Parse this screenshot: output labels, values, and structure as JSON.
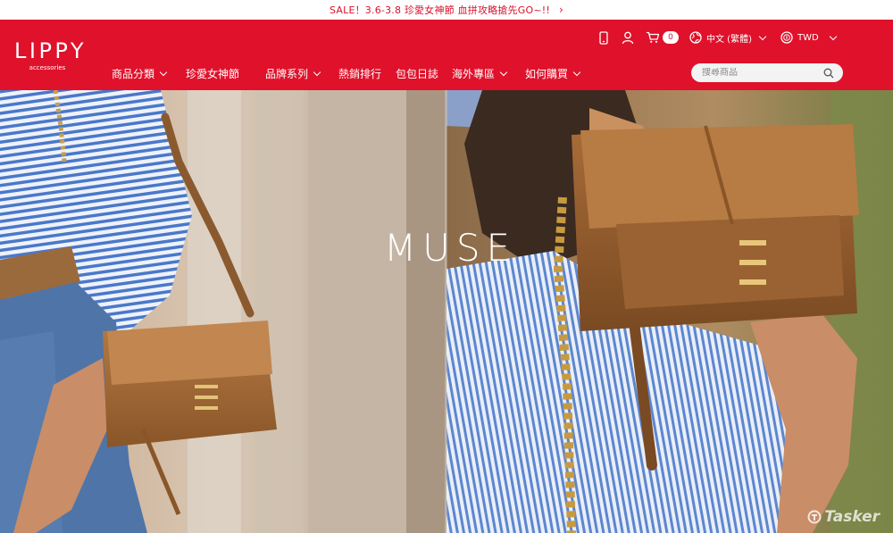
{
  "announcement": {
    "text": "SALE！3.6-3.8 珍愛女神節 血拼攻略搶先GO~!!"
  },
  "brand": {
    "name": "LIPPY",
    "tagline": "accessories"
  },
  "topbar": {
    "cart_count": "0",
    "language": "中文 (繁體)",
    "currency": "TWD"
  },
  "nav": {
    "items": [
      "商品分類",
      "珍愛女神節",
      "品牌系列",
      "熱銷排行",
      "包包日誌",
      "海外專區",
      "如何購買"
    ]
  },
  "search": {
    "placeholder": "搜尋商品"
  },
  "hero": {
    "title": "MUSE"
  },
  "watermark": {
    "text": "Tasker"
  },
  "colors": {
    "brand_red": "#e0112b",
    "announcement_text": "#d9122c"
  },
  "icons": [
    "mobile-icon",
    "user-icon",
    "cart-icon",
    "globe-icon",
    "currency-icon",
    "search-icon",
    "chevron-right-icon",
    "chevron-down-icon"
  ]
}
